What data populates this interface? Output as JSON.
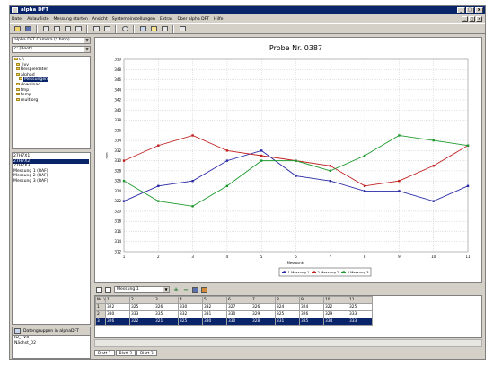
{
  "window": {
    "title": "alpha DFT",
    "controls": [
      "_",
      "□",
      "x"
    ]
  },
  "menu": {
    "items": [
      "Datei",
      "Ablaufliste",
      "Messung starten",
      "Ansicht",
      "Systemeinstellungen",
      "Extras",
      "Über alpha DFT",
      "Hilfe"
    ]
  },
  "toolbar": {
    "icons": [
      "open-icon",
      "save-icon",
      "measure-icon",
      "measure-icon",
      "measure-icon",
      "measure-icon",
      "print-icon",
      "print-preview-icon",
      "clock-icon",
      "help-icon",
      "lamp-icon",
      "probe-icon",
      "export-icon"
    ]
  },
  "left": {
    "device": "alpha DFT Camera (*.bmp)",
    "drive": "c: [Boot]",
    "tree": [
      {
        "label": "c:\\",
        "level": 0,
        "selected": false
      },
      {
        "label": "_lvv",
        "level": 1,
        "selected": false
      },
      {
        "label": "Beispieldaten",
        "level": 1,
        "selected": false
      },
      {
        "label": "alphad",
        "level": 1,
        "selected": false
      },
      {
        "label": "Messungen",
        "level": 2,
        "selected": true
      },
      {
        "label": "download",
        "level": 1,
        "selected": false
      },
      {
        "label": "tmp",
        "level": 1,
        "selected": false
      },
      {
        "label": "temp",
        "level": 1,
        "selected": false
      },
      {
        "label": "multiorg",
        "level": 1,
        "selected": false
      }
    ],
    "measurements": [
      {
        "label": "27H7X1",
        "selected": false
      },
      {
        "label": "27H7X2",
        "selected": true
      },
      {
        "label": "27H7X3",
        "selected": false
      },
      {
        "label": "Messung 1 (RAF)",
        "selected": false
      },
      {
        "label": "Messung 2 (RAF)",
        "selected": false
      },
      {
        "label": "Messung 3 (RAF)",
        "selected": false
      }
    ],
    "group_header": "Datengruppen in alphaDFT",
    "group_lines": [
      "ID_TVS",
      "Nächst_02"
    ]
  },
  "chart_data": {
    "type": "line",
    "title": "Probe Nr. 0387",
    "xlabel": "Messpunkt",
    "ylabel": "mm",
    "x": [
      1,
      2,
      3,
      4,
      5,
      6,
      7,
      8,
      9,
      10,
      11
    ],
    "ylim": [
      312,
      350
    ],
    "yticks": [
      312,
      314,
      316,
      318,
      320,
      322,
      324,
      326,
      328,
      330,
      332,
      334,
      336,
      338,
      340,
      342,
      344,
      346,
      348,
      350
    ],
    "grid": true,
    "legend_position": "bottom",
    "series": [
      {
        "name": "1.Messung 1",
        "color": "#2a2aa8",
        "values": [
          322,
          325,
          326,
          330,
          332,
          327,
          326,
          324,
          324,
          322,
          325
        ]
      },
      {
        "name": "2.Messung 2",
        "color": "#c02020",
        "values": [
          330,
          333,
          335,
          332,
          331,
          330,
          329,
          325,
          326,
          329,
          333
        ]
      },
      {
        "name": "3.Messung 3",
        "color": "#1f9a2f",
        "values": [
          326,
          322,
          321,
          325,
          330,
          330,
          328,
          331,
          335,
          334,
          333
        ]
      }
    ]
  },
  "table_bar": {
    "selected_measurement": "Messung 1"
  },
  "grid": {
    "header": [
      "Nr. \\ ",
      "1",
      "2",
      "3",
      "4",
      "5",
      "6",
      "7",
      "8",
      "9",
      "10",
      "11"
    ],
    "rows": [
      {
        "id": "1",
        "cells": [
          "322",
          "325",
          "326",
          "330",
          "332",
          "327",
          "326",
          "324",
          "324",
          "322",
          "325"
        ],
        "selected": false
      },
      {
        "id": "2",
        "cells": [
          "330",
          "333",
          "335",
          "332",
          "331",
          "330",
          "329",
          "325",
          "326",
          "329",
          "333"
        ],
        "selected": false
      },
      {
        "id": "3",
        "cells": [
          "326",
          "322",
          "321",
          "325",
          "330",
          "330",
          "328",
          "331",
          "335",
          "334",
          "333"
        ],
        "selected": true
      }
    ]
  },
  "sheets": [
    "Blatt 1",
    "Blatt 2",
    "Blatt 3"
  ]
}
